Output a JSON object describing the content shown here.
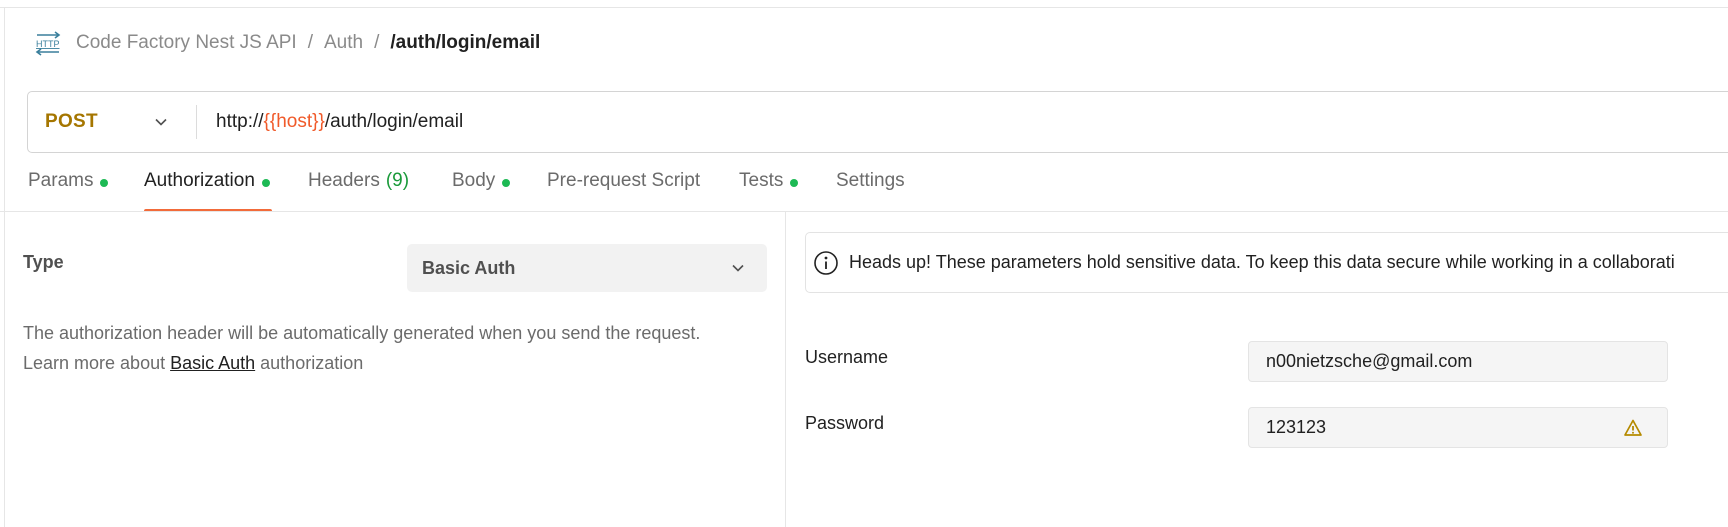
{
  "breadcrumb": {
    "icon": "http-request-icon",
    "items": [
      "Code Factory Nest JS API",
      "Auth"
    ],
    "separator": "/",
    "current": "/auth/login/email"
  },
  "request": {
    "method": "POST",
    "url_prefix": "http://",
    "url_variable": "{{host}}",
    "url_suffix": "/auth/login/email"
  },
  "tabs": {
    "params": "Params",
    "authorization": "Authorization",
    "headers": "Headers",
    "headers_count": "(9)",
    "body": "Body",
    "prerequest": "Pre-request Script",
    "tests": "Tests",
    "settings": "Settings",
    "active": "Authorization"
  },
  "auth": {
    "type_label": "Type",
    "type_value": "Basic Auth",
    "description_line1": "The authorization header will be automatically generated when you send the request.",
    "description_line2_prefix": "Learn more about ",
    "description_link": "Basic Auth",
    "description_line2_suffix": " authorization",
    "notice": "Heads up! These parameters hold sensitive data. To keep this data secure while working in a collaborati",
    "username_label": "Username",
    "username_value": "n00nietzsche@gmail.com",
    "password_label": "Password",
    "password_value": "123123"
  },
  "colors": {
    "method_post": "#a57600",
    "url_variable": "#f05a2a",
    "tab_indicator": "#f26b3a",
    "status_dot": "#1db954",
    "headers_count": "#1a9a3a",
    "warning": "#b58a00"
  }
}
